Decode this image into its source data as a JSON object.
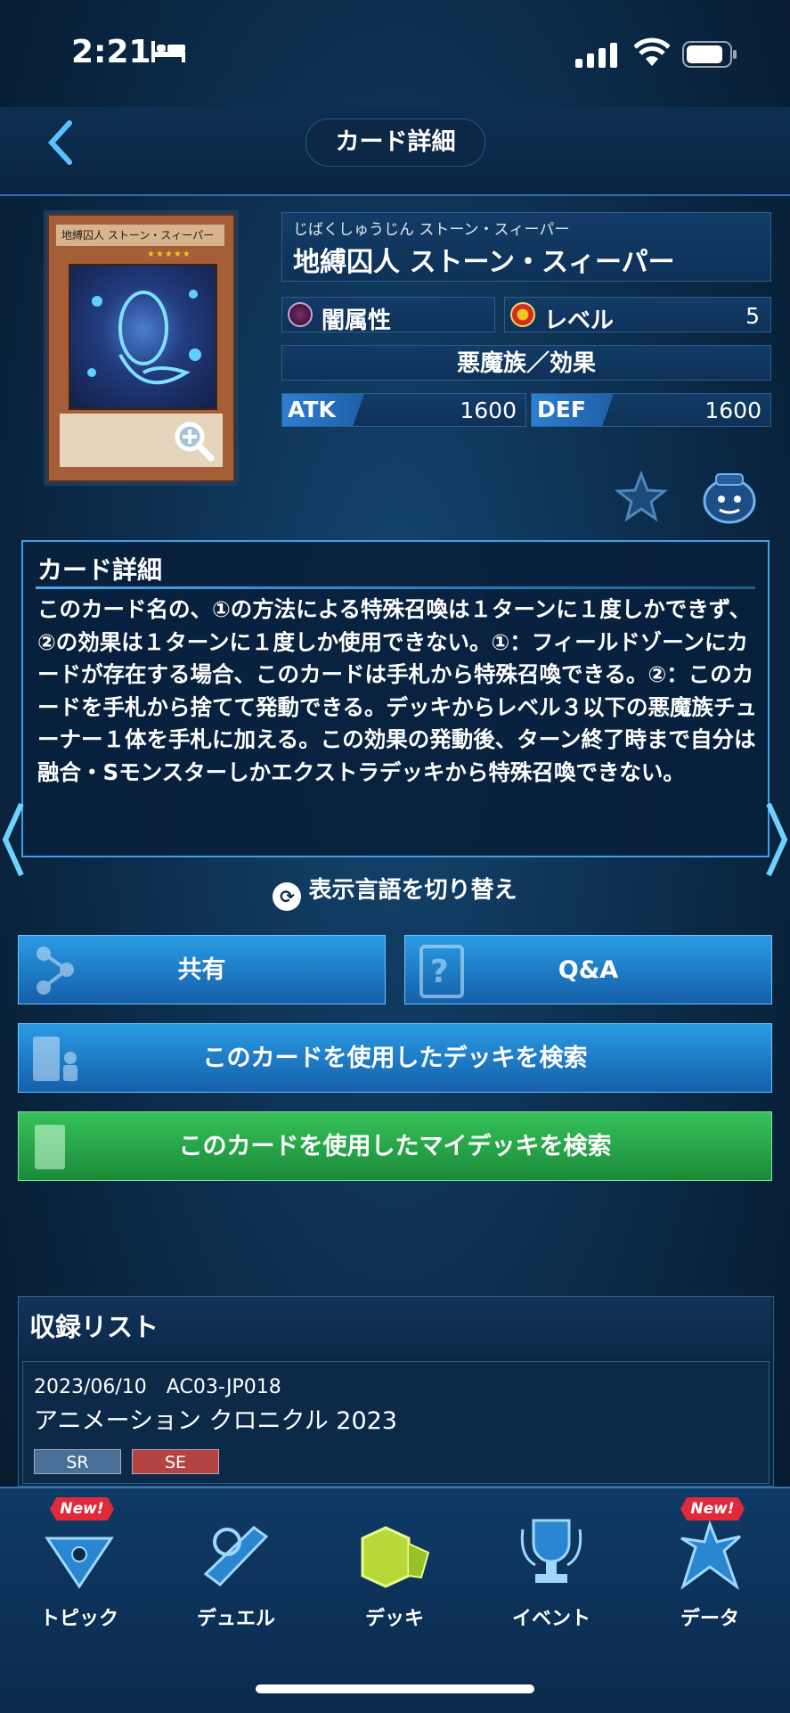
{
  "status_bar": {
    "time": "2:21"
  },
  "header": {
    "title": "カード詳細"
  },
  "card": {
    "image_name": "地縛囚人 ストーン・スィーパー",
    "reading": "じばくしゅうじん ストーン・スィーパー",
    "name": "地縛囚人 ストーン・スィーパー",
    "attribute_label": "闇属性",
    "level_label": "レベル",
    "level": "5",
    "type": "悪魔族／効果",
    "atk_label": "ATK",
    "atk": "1600",
    "def_label": "DEF",
    "def": "1600"
  },
  "description": {
    "title": "カード詳細",
    "text": "このカード名の、①の方法による特殊召喚は１ターンに１度しかできず、②の効果は１ターンに１度しか使用できない。①：フィールドゾーンにカードが存在する場合、このカードは手札から特殊召喚できる。②：このカードを手札から捨てて発動できる。デッキからレベル３以下の悪魔族チューナー１体を手札に加える。この効果の発動後、ターン終了時まで自分は融合・Sモンスターしかエクストラデッキから特殊召喚できない。"
  },
  "lang_toggle": {
    "label": "表示言語を切り替え"
  },
  "buttons": {
    "share": "共有",
    "qa": "Q&A",
    "search_decks": "このカードを使用したデッキを検索",
    "search_my_decks": "このカードを使用したマイデッキを検索"
  },
  "release_list": {
    "title": "収録リスト",
    "items": [
      {
        "date_code": "2023/06/10　AC03-JP018",
        "name": "アニメーション クロニクル 2023",
        "rarities": [
          "SR",
          "SE"
        ]
      }
    ]
  },
  "nav": {
    "items": [
      {
        "label": "トピック",
        "badge": "New!"
      },
      {
        "label": "デュエル"
      },
      {
        "label": "デッキ"
      },
      {
        "label": "イベント"
      },
      {
        "label": "データ",
        "badge": "New!"
      }
    ]
  },
  "colors": {
    "accent_blue": "#2a9be4",
    "accent_green": "#37c25a",
    "badge_red": "#e0293a"
  }
}
